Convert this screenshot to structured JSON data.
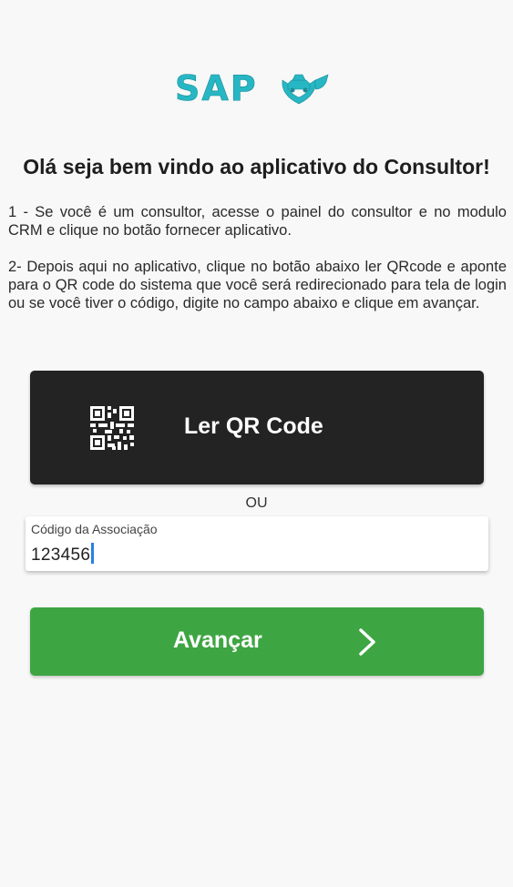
{
  "logo": {
    "text": "SAP"
  },
  "welcome": {
    "title": "Olá seja bem vindo ao aplicativo do Consultor!"
  },
  "instructions": {
    "step1": "1 - Se você é um consultor, acesse o painel do consultor e no modulo CRM  e clique no botão fornecer aplicativo.",
    "step2": "2- Depois aqui no aplicativo, clique no botão abaixo ler QRcode  e aponte para o QR code do sistema que você será redirecionado para tela de login ou se você tiver o código, digite no campo abaixo e clique em avançar."
  },
  "qr_button": {
    "label": "Ler QR Code",
    "icon": "qr-code-icon"
  },
  "separator": {
    "text": "OU"
  },
  "association_field": {
    "label": "Código da Associação",
    "value": "123456"
  },
  "advance_button": {
    "label": "Avançar",
    "icon": "chevron-right-icon"
  },
  "colors": {
    "background": "#f8f8f8",
    "logo_teal": "#27b7c4",
    "qr_button_bg": "#232323",
    "advance_button_bg": "#3ea543",
    "caret": "#2b7fe6"
  }
}
